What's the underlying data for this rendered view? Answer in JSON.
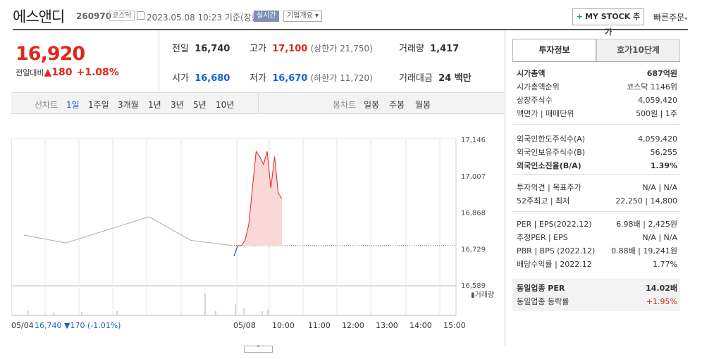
{
  "header": {
    "name": "에스앤디",
    "code": "260970",
    "market": "코스닥",
    "datetime": "2023.05.08 10:23  기준(장중)",
    "realtime": "실시간",
    "company_info": "기업개요",
    "mystock": "MY STOCK 추가",
    "quick_order": "빠른주문"
  },
  "price": {
    "current": "16,920",
    "prev_label": "전일대비",
    "change": "180",
    "percent": "+1.08%"
  },
  "stats": {
    "prev_label": "전일",
    "prev": "16,740",
    "high_label": "고가",
    "high": "17,100",
    "upper": "(상한가 21,750)",
    "vol_label": "거래량",
    "vol": "1,417",
    "open_label": "시가",
    "open": "16,680",
    "low_label": "저가",
    "low": "16,670",
    "lower": "(하한가 11,720)",
    "amt_label": "거래대금",
    "amt": "24 백만"
  },
  "tabs": {
    "line_label": "선차트",
    "periods": [
      "1일",
      "1주일",
      "3개월",
      "1년",
      "3년",
      "5년",
      "10년"
    ],
    "candle_label": "봉차트",
    "candles": [
      "일봉",
      "주봉",
      "월봉"
    ]
  },
  "chart_data": {
    "type": "line",
    "ylabels": [
      "17,146",
      "17,007",
      "16,868",
      "16,729",
      "16,589"
    ],
    "xlabels": [
      "05/08",
      "10:00",
      "11:00",
      "12:00",
      "13:00",
      "14:00",
      "15:00"
    ],
    "left_date": "05/04",
    "prev_summary": "16,740 ▼170 (-1.01%)",
    "volume_label": "거래량",
    "ylim": [
      16589,
      17146
    ],
    "prev_close": 16740,
    "prev_series": [
      16780,
      16750,
      16800,
      16850,
      16760,
      16740
    ],
    "today_series": [
      16700,
      16740,
      16740,
      16760,
      16820,
      16960,
      17100,
      17080,
      17050,
      17100,
      16960,
      17080,
      16940,
      16920
    ],
    "colors": {
      "up": "#e0271a",
      "down": "#1a5fd4",
      "prev": "#aaaaaa",
      "fill": "#fbd7d7"
    }
  },
  "right": {
    "tab_info": "투자정보",
    "tab_quote": "호가10단계",
    "rows1": [
      {
        "l": "시가총액",
        "r": "687억원"
      },
      {
        "l": "시가총액순위",
        "r": "코스닥 1146위"
      },
      {
        "l": "상장주식수",
        "r": "4,059,420"
      },
      {
        "l": "액면가 | 매매단위",
        "r": "500원 | 1주"
      }
    ],
    "rows2": [
      {
        "l": "외국인한도주식수(A)",
        "r": "4,059,420"
      },
      {
        "l": "외국인보유주식수(B)",
        "r": "56,255"
      },
      {
        "l": "외국인소진율(B/A)",
        "r": "1.39%"
      }
    ],
    "rows3": [
      {
        "l": "투자의견 | 목표주가",
        "r": "N/A | N/A"
      },
      {
        "l": "52주최고 | 최저",
        "r": "22,250 | 14,800"
      }
    ],
    "rows4": [
      {
        "l": "PER | EPS(2022.12)",
        "r": "6.98배 | 2,425원"
      },
      {
        "l": "추정PER | EPS",
        "r": "N/A | N/A"
      },
      {
        "l": "PBR | BPS (2022.12)",
        "r": "0.88배 | 19,241원"
      },
      {
        "l": "배당수익률 | 2022.12",
        "r": "1.77%"
      }
    ],
    "rows5": [
      {
        "l": "동일업종 PER",
        "r": "14.02배"
      },
      {
        "l": "동일업종 등락률",
        "r": "+1.95%"
      }
    ]
  }
}
